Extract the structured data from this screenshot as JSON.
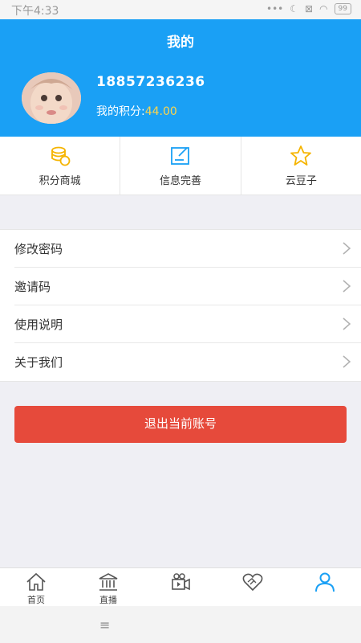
{
  "status_bar": {
    "time": "下午4:33",
    "battery": "99"
  },
  "header": {
    "title": "我的",
    "phone": "18857236236",
    "points_label": "我的积分:",
    "points_value": "44.00"
  },
  "quick_actions": [
    {
      "label": "积分商城",
      "icon": "coins-icon"
    },
    {
      "label": "信息完善",
      "icon": "edit-profile-icon"
    },
    {
      "label": "云豆子",
      "icon": "star-icon"
    }
  ],
  "menu": [
    {
      "label": "修改密码"
    },
    {
      "label": "邀请码"
    },
    {
      "label": "使用说明"
    },
    {
      "label": "关于我们"
    }
  ],
  "logout_label": "退出当前账号",
  "tabs": [
    {
      "label": "首页",
      "icon": "home-icon"
    },
    {
      "label": "直播",
      "icon": "bank-icon"
    },
    {
      "label": "",
      "icon": "video-camera-icon"
    },
    {
      "label": "",
      "icon": "handshake-heart-icon"
    },
    {
      "label": "",
      "icon": "user-icon"
    }
  ],
  "colors": {
    "accent": "#1aa0f5",
    "logout": "#e64a3b",
    "points": "#ffd54a",
    "icon_gold": "#f5b400"
  }
}
